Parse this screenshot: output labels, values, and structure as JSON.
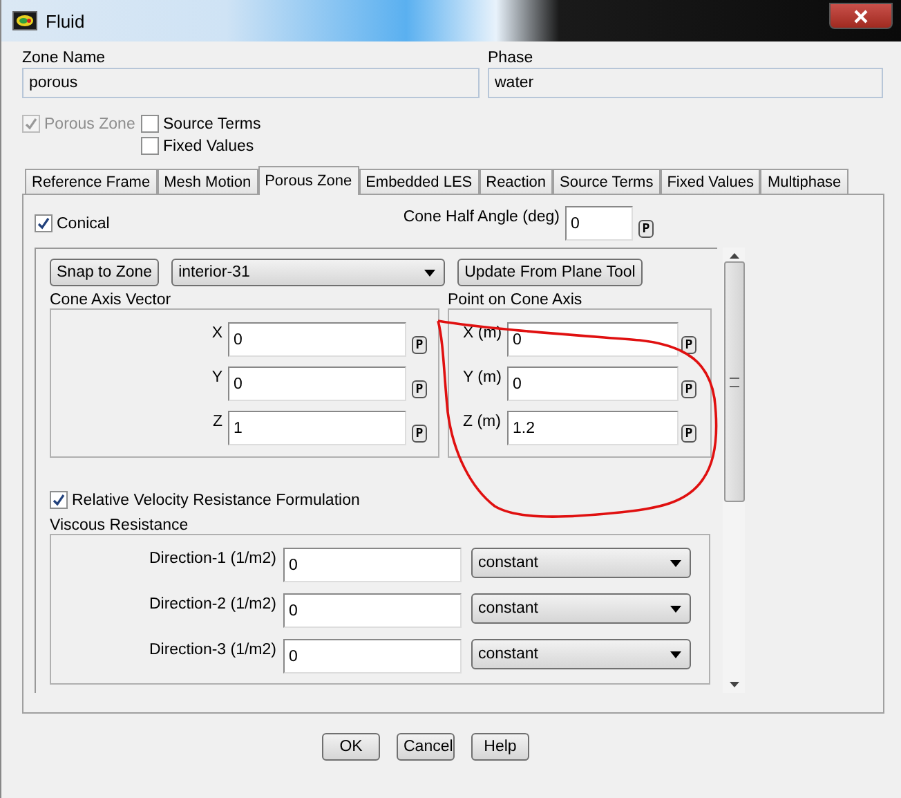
{
  "window": {
    "title": "Fluid"
  },
  "zone_name": {
    "label": "Zone Name",
    "value": "porous"
  },
  "phase": {
    "label": "Phase",
    "value": "water"
  },
  "options": [
    {
      "label": "Porous Zone",
      "checked": true,
      "disabled": true
    },
    {
      "label": "Source Terms",
      "checked": false,
      "disabled": false
    },
    {
      "label": "Fixed Values",
      "checked": false,
      "disabled": false
    }
  ],
  "tabs": [
    {
      "label": "Reference Frame",
      "selected": false
    },
    {
      "label": "Mesh Motion",
      "selected": false
    },
    {
      "label": "Porous Zone",
      "selected": true
    },
    {
      "label": "Embedded LES",
      "selected": false
    },
    {
      "label": "Reaction",
      "selected": false
    },
    {
      "label": "Source Terms",
      "selected": false
    },
    {
      "label": "Fixed Values",
      "selected": false
    },
    {
      "label": "Multiphase",
      "selected": false
    }
  ],
  "conical": {
    "label": "Conical",
    "checked": true
  },
  "cone_half_angle": {
    "label": "Cone Half Angle (deg)",
    "value": "0",
    "p": "P"
  },
  "snap_button": "Snap to Zone",
  "zone_select": "interior-31",
  "update_button": "Update From Plane Tool",
  "cone_axis_vector": {
    "title": "Cone Axis Vector",
    "fields": [
      {
        "label": "X",
        "value": "0",
        "p": "P"
      },
      {
        "label": "Y",
        "value": "0",
        "p": "P"
      },
      {
        "label": "Z",
        "value": "1",
        "p": "P"
      }
    ]
  },
  "point_on_cone_axis": {
    "title": "Point on Cone Axis",
    "fields": [
      {
        "label": "X (m)",
        "value": "0",
        "p": "P"
      },
      {
        "label": "Y (m)",
        "value": "0",
        "p": "P"
      },
      {
        "label": "Z (m)",
        "value": "1.2",
        "p": "P"
      }
    ]
  },
  "relative_velocity": {
    "label": "Relative Velocity Resistance Formulation",
    "checked": true
  },
  "viscous_resistance": {
    "title": "Viscous Resistance",
    "rows": [
      {
        "label": "Direction-1 (1/m2)",
        "value": "0",
        "method": "constant"
      },
      {
        "label": "Direction-2 (1/m2)",
        "value": "0",
        "method": "constant"
      },
      {
        "label": "Direction-3 (1/m2)",
        "value": "0",
        "method": "constant"
      }
    ]
  },
  "buttons": [
    "OK",
    "Cancel",
    "Help"
  ]
}
